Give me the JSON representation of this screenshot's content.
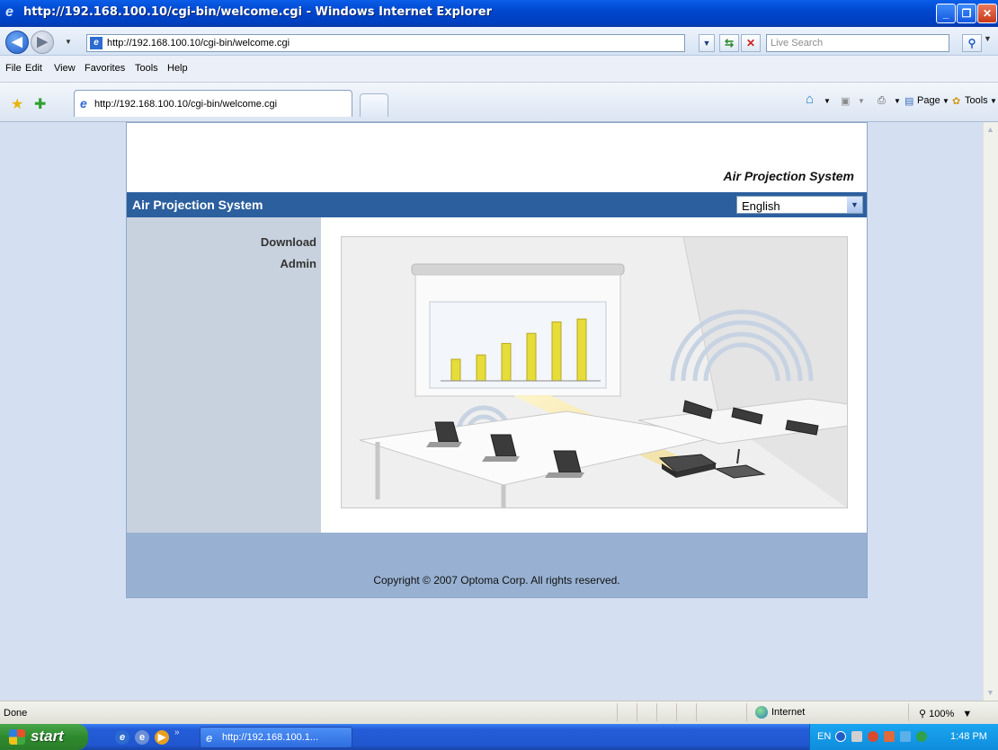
{
  "window": {
    "title": "http://192.168.100.10/cgi-bin/welcome.cgi - Windows Internet Explorer"
  },
  "address_bar": {
    "url": "http://192.168.100.10/cgi-bin/welcome.cgi",
    "search_placeholder": "Live Search"
  },
  "menu": {
    "items": [
      "File",
      "Edit",
      "View",
      "Favorites",
      "Tools",
      "Help"
    ]
  },
  "tab": {
    "label": "http://192.168.100.10/cgi-bin/welcome.cgi"
  },
  "command_bar": {
    "page": "Page",
    "tools": "Tools"
  },
  "page": {
    "brand_top": "Air Projection System",
    "header_title": "Air Projection System",
    "language": "English",
    "nav": [
      "Download",
      "Admin"
    ],
    "footer": "Copyright © 2007 Optoma Corp. All rights reserved.",
    "hero_chart_values": [
      30,
      36,
      52,
      66,
      82,
      86
    ]
  },
  "status": {
    "text": "Done",
    "zone": "Internet",
    "zoom": "100%"
  },
  "taskbar": {
    "start": "start",
    "task_label": "http://192.168.100.1...",
    "tray_lang": "EN",
    "clock": "1:48 PM"
  },
  "colors": {
    "header_bar": "#2c5f9e",
    "footer": "#98b1d2",
    "sidebar": "#c8d2de",
    "viewport": "#d4dff2"
  }
}
